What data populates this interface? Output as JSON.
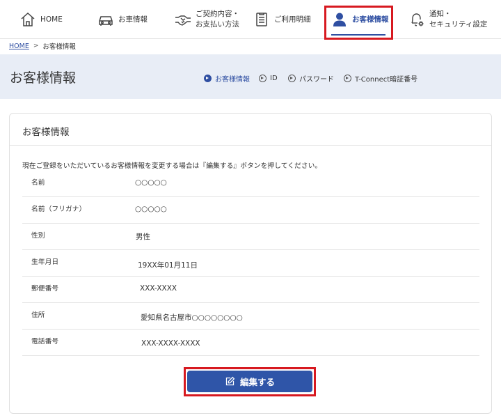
{
  "nav": {
    "items": [
      {
        "label": "HOME",
        "icon": "home-icon"
      },
      {
        "label": "お車情報",
        "icon": "car-icon"
      },
      {
        "label": "ご契約内容・\nお支払い方法",
        "icon": "handshake-icon"
      },
      {
        "label": "ご利用明細",
        "icon": "document-icon"
      },
      {
        "label": "お客様情報",
        "icon": "user-icon",
        "active": true
      },
      {
        "label": "通知・\nセキュリティ設定",
        "icon": "bell-gear-icon"
      }
    ]
  },
  "breadcrumb": {
    "home": "HOME",
    "separator": ">",
    "current": "お客様情報"
  },
  "page_title": "お客様情報",
  "subnav": {
    "items": [
      {
        "label": "お客様情報",
        "active": true
      },
      {
        "label": "ID"
      },
      {
        "label": "パスワード"
      },
      {
        "label": "T-Connect暗証番号"
      }
    ]
  },
  "card": {
    "title": "お客様情報",
    "description": "現在ご登録をいただいているお客様情報を変更する場合は『編集する』ボタンを押してください。",
    "rows": [
      {
        "label": "名前",
        "value": "○○○○○"
      },
      {
        "label": "名前（フリガナ）",
        "value": "○○○○○"
      },
      {
        "label": "性別",
        "value": "男性"
      },
      {
        "label": "生年月日",
        "value": "19XX年01月11日"
      },
      {
        "label": "郵便番号",
        "value": "XXX-XXXX"
      },
      {
        "label": "住所",
        "value": "愛知県名古屋市○○○○○○○○"
      },
      {
        "label": "電話番号",
        "value": "XXX-XXXX-XXXX"
      }
    ],
    "edit_button": "編集する"
  },
  "colors": {
    "accent": "#2f4fa2",
    "button": "#2f55a8",
    "highlight": "#d71920",
    "band": "#e8edf6"
  }
}
